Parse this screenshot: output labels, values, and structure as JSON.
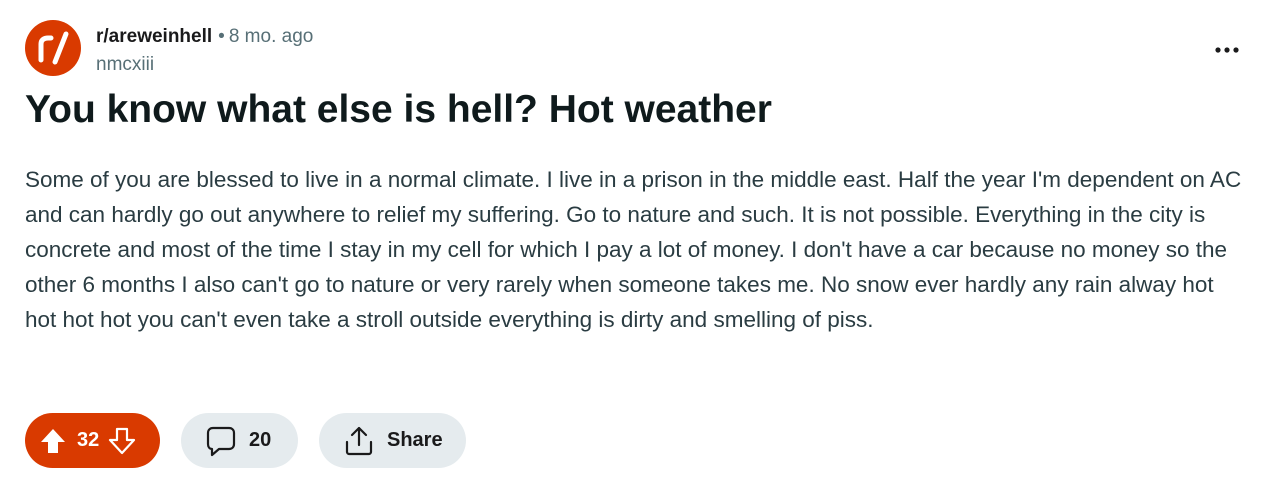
{
  "post": {
    "subreddit": "r/areweinhell",
    "separator": "•",
    "time_ago": "8 mo. ago",
    "author": "nmcxiii",
    "title": "You know what else is hell? Hot weather",
    "body": "Some of you are blessed to live in a normal climate. I live in a prison in the middle east. Half the year I'm dependent on AC and can hardly go out anywhere to relief my suffering. Go to nature and such. It is not possible. Everything in the city is concrete and most of the time I stay in my cell for which I pay a lot of money. I don't have a car because no money so the other 6 months I also can't go to nature or very rarely when someone takes me. No snow ever hardly any rain alway hot hot hot hot you can't even take a stroll outside everything is dirty and smelling of piss."
  },
  "actions": {
    "vote_count": "32",
    "comment_count": "20",
    "share_label": "Share"
  },
  "icons": {
    "avatar": "subreddit-r-slash-logo",
    "overflow": "more-horizontal-icon",
    "upvote": "upvote-filled-arrow-icon",
    "downvote": "downvote-outline-arrow-icon",
    "comment": "comment-bubble-icon",
    "share": "share-upload-icon"
  },
  "colors": {
    "accent": "#d93a00",
    "button_bg": "#e5ebee",
    "muted_text": "#576f76",
    "body_text": "#2a3c42"
  }
}
